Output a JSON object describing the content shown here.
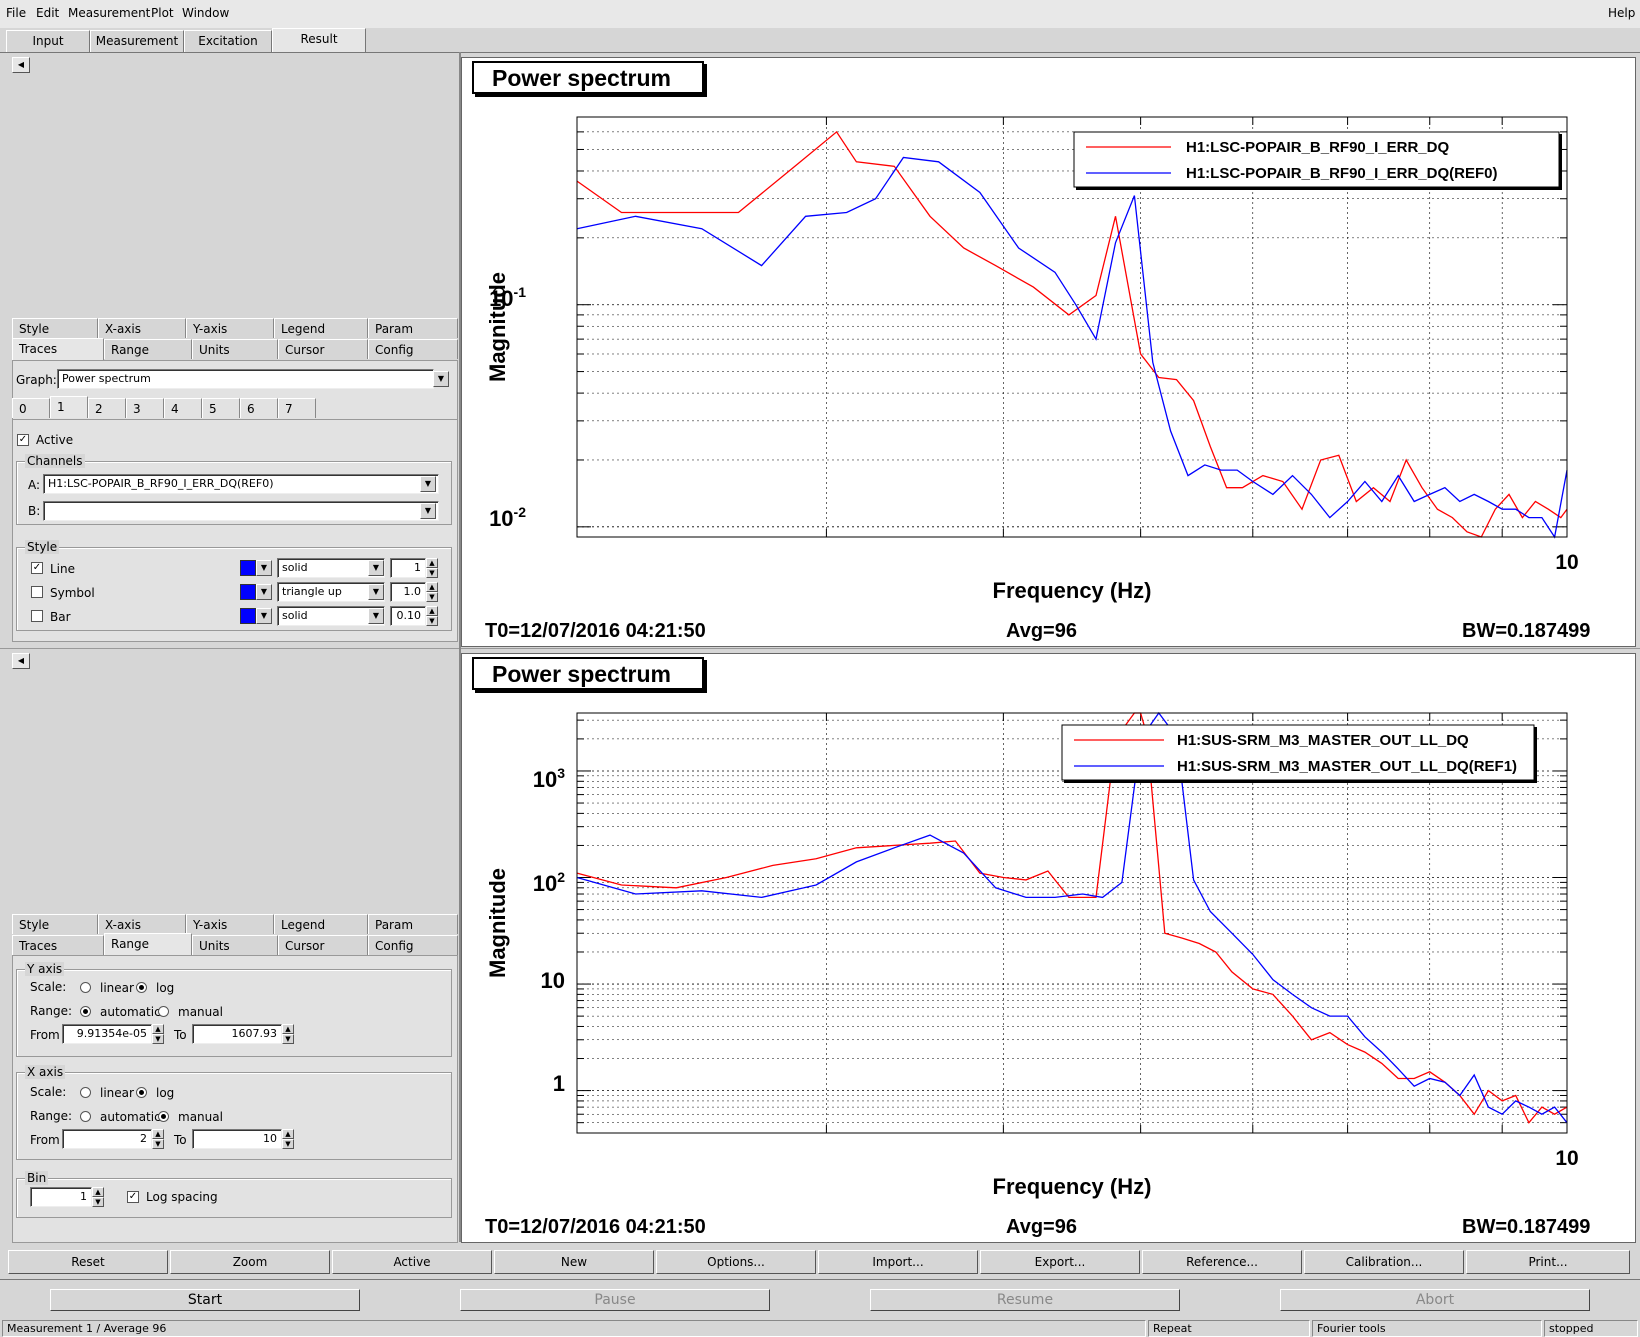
{
  "menu": {
    "file": "File",
    "edit": "Edit",
    "measurement": "Measurement",
    "plot": "Plot",
    "window": "Window",
    "help": "Help"
  },
  "main_tabs": {
    "input": "Input",
    "measurement": "Measurement",
    "excitation": "Excitation",
    "result": "Result"
  },
  "panel_tabs": {
    "style": "Style",
    "xaxis": "X-axis",
    "yaxis": "Y-axis",
    "legend": "Legend",
    "param": "Param",
    "traces": "Traces",
    "range": "Range",
    "units": "Units",
    "cursor": "Cursor",
    "config": "Config"
  },
  "traces_panel": {
    "graph_label": "Graph:",
    "graph_value": "Power spectrum",
    "trace_tabs": [
      "0",
      "1",
      "2",
      "3",
      "4",
      "5",
      "6",
      "7"
    ],
    "active_label": "Active",
    "channels_title": "Channels",
    "a_label": "A:",
    "a_value": "H1:LSC-POPAIR_B_RF90_I_ERR_DQ(REF0)",
    "b_label": "B:",
    "b_value": "",
    "style_title": "Style",
    "line_label": "Line",
    "symbol_label": "Symbol",
    "bar_label": "Bar",
    "line_style": "solid",
    "symbol_style": "triangle up",
    "bar_style": "solid",
    "line_width": "1",
    "symbol_size": "1.0",
    "bar_width": "0.10",
    "swatch_color": "#0000ff"
  },
  "range_panel": {
    "yaxis_title": "Y axis",
    "scale_label": "Scale:",
    "linear": "linear",
    "log": "log",
    "range_label": "Range:",
    "automatic": "automatic",
    "manual": "manual",
    "from_label": "From",
    "to_label": "To",
    "y_from": "9.91354e-05",
    "y_to": "1607.93",
    "xaxis_title": "X axis",
    "x_from": "2",
    "x_to": "10",
    "bin_title": "Bin",
    "bin_value": "1",
    "log_spacing": "Log spacing"
  },
  "plots": [
    {
      "title": "Power spectrum",
      "ylabel": "Magnitude",
      "xlabel": "Frequency (Hz)",
      "x_tick": "10",
      "t0": "T0=12/07/2016 04:21:50",
      "avg": "Avg=96",
      "bw": "BW=0.187499",
      "legend": [
        "H1:LSC-POPAIR_B_RF90_I_ERR_DQ",
        "H1:LSC-POPAIR_B_RF90_I_ERR_DQ(REF0)"
      ]
    },
    {
      "title": "Power spectrum",
      "ylabel": "Magnitude",
      "xlabel": "Frequency (Hz)",
      "x_tick": "10",
      "t0": "T0=12/07/2016 04:21:50",
      "avg": "Avg=96",
      "bw": "BW=0.187499",
      "legend": [
        "H1:SUS-SRM_M3_MASTER_OUT_LL_DQ",
        "H1:SUS-SRM_M3_MASTER_OUT_LL_DQ(REF1)"
      ]
    }
  ],
  "chart_data": [
    {
      "type": "line",
      "title": "Power spectrum",
      "xlabel": "Frequency (Hz)",
      "ylabel": "Magnitude",
      "xscale": "log",
      "yscale": "log",
      "xlim": [
        2,
        10
      ],
      "ylim": [
        0.009,
        0.7
      ],
      "y_tick_labels": [
        "10^-1",
        "10^-2"
      ],
      "x_tick_labels": [
        "10"
      ],
      "grid": true,
      "legend_position": "top-right",
      "series": [
        {
          "name": "H1:LSC-POPAIR_B_RF90_I_ERR_DQ",
          "color": "#ff0000",
          "x": [
            2.0,
            2.15,
            2.4,
            2.6,
            2.85,
            3.05,
            3.15,
            3.35,
            3.55,
            3.75,
            3.95,
            4.2,
            4.45,
            4.65,
            4.8,
            5.0,
            5.15,
            5.3,
            5.45,
            5.6,
            5.75,
            5.9,
            6.1,
            6.3,
            6.5,
            6.7,
            6.9,
            7.1,
            7.3,
            7.5,
            7.7,
            7.9,
            8.1,
            8.3,
            8.5,
            8.7,
            8.9,
            9.1,
            9.3,
            9.5,
            9.7,
            9.9,
            10.0
          ],
          "y": [
            0.36,
            0.26,
            0.26,
            0.26,
            0.42,
            0.6,
            0.44,
            0.42,
            0.25,
            0.18,
            0.15,
            0.12,
            0.09,
            0.11,
            0.25,
            0.06,
            0.047,
            0.046,
            0.037,
            0.023,
            0.015,
            0.015,
            0.017,
            0.016,
            0.012,
            0.02,
            0.021,
            0.013,
            0.015,
            0.013,
            0.02,
            0.015,
            0.012,
            0.011,
            0.0095,
            0.009,
            0.012,
            0.014,
            0.011,
            0.013,
            0.012,
            0.011,
            0.012
          ]
        },
        {
          "name": "H1:LSC-POPAIR_B_RF90_I_ERR_DQ(REF0)",
          "color": "#0000ff",
          "x": [
            2.0,
            2.2,
            2.45,
            2.7,
            2.9,
            3.1,
            3.25,
            3.4,
            3.6,
            3.85,
            4.1,
            4.35,
            4.5,
            4.65,
            4.8,
            4.95,
            5.1,
            5.25,
            5.4,
            5.55,
            5.7,
            5.85,
            6.0,
            6.2,
            6.4,
            6.6,
            6.8,
            7.0,
            7.2,
            7.4,
            7.6,
            7.8,
            8.0,
            8.2,
            8.4,
            8.6,
            8.8,
            9.0,
            9.2,
            9.4,
            9.6,
            9.8,
            10.0
          ],
          "y": [
            0.22,
            0.25,
            0.22,
            0.15,
            0.25,
            0.26,
            0.3,
            0.46,
            0.44,
            0.32,
            0.18,
            0.14,
            0.1,
            0.07,
            0.19,
            0.31,
            0.055,
            0.027,
            0.017,
            0.019,
            0.018,
            0.018,
            0.016,
            0.014,
            0.017,
            0.014,
            0.011,
            0.013,
            0.016,
            0.013,
            0.017,
            0.013,
            0.014,
            0.015,
            0.013,
            0.014,
            0.013,
            0.012,
            0.012,
            0.011,
            0.011,
            0.009,
            0.018
          ]
        }
      ]
    },
    {
      "type": "line",
      "title": "Power spectrum",
      "xlabel": "Frequency (Hz)",
      "ylabel": "Magnitude",
      "xscale": "log",
      "yscale": "log",
      "xlim": [
        2,
        10
      ],
      "ylim": [
        0.4,
        3500
      ],
      "y_tick_labels": [
        "10^3",
        "10^2",
        "10",
        "1"
      ],
      "x_tick_labels": [
        "10"
      ],
      "grid": true,
      "legend_position": "top-right",
      "series": [
        {
          "name": "H1:SUS-SRM_M3_MASTER_OUT_LL_DQ",
          "color": "#ff0000",
          "x": [
            2.0,
            2.15,
            2.35,
            2.55,
            2.75,
            2.95,
            3.15,
            3.35,
            3.55,
            3.7,
            3.85,
            4.0,
            4.15,
            4.3,
            4.45,
            4.55,
            4.65,
            4.8,
            4.95,
            5.0,
            5.05,
            5.2,
            5.35,
            5.5,
            5.65,
            5.8,
            6.0,
            6.2,
            6.4,
            6.6,
            6.8,
            7.0,
            7.2,
            7.4,
            7.6,
            7.8,
            8.0,
            8.2,
            8.4,
            8.6,
            8.8,
            9.0,
            9.2,
            9.4,
            9.6,
            9.8,
            10.0
          ],
          "y": [
            110,
            85,
            80,
            100,
            130,
            150,
            190,
            200,
            210,
            220,
            110,
            100,
            95,
            115,
            65,
            65,
            65,
            2000,
            3800,
            3600,
            2200,
            30,
            27,
            24,
            20,
            13,
            9,
            8,
            5,
            3,
            3.5,
            2.7,
            2.3,
            1.8,
            1.3,
            1.3,
            1.5,
            1.2,
            0.9,
            0.6,
            1.0,
            0.8,
            0.9,
            0.5,
            0.7,
            0.6,
            0.7
          ]
        },
        {
          "name": "H1:SUS-SRM_M3_MASTER_OUT_LL_DQ(REF1)",
          "color": "#0000ff",
          "x": [
            2.0,
            2.2,
            2.45,
            2.7,
            2.95,
            3.15,
            3.35,
            3.55,
            3.75,
            3.95,
            4.15,
            4.35,
            4.55,
            4.7,
            4.85,
            5.0,
            5.15,
            5.3,
            5.45,
            5.6,
            5.8,
            6.0,
            6.2,
            6.4,
            6.6,
            6.8,
            7.0,
            7.2,
            7.4,
            7.6,
            7.8,
            8.0,
            8.2,
            8.4,
            8.6,
            8.8,
            9.0,
            9.2,
            9.4,
            9.6,
            9.8,
            10.0
          ],
          "y": [
            100,
            70,
            75,
            65,
            85,
            140,
            190,
            250,
            170,
            80,
            65,
            65,
            70,
            65,
            90,
            2000,
            3700,
            2100,
            95,
            48,
            30,
            19,
            11,
            8,
            6,
            5,
            5,
            3.2,
            2.3,
            1.6,
            1.1,
            1.3,
            1.2,
            0.9,
            1.4,
            0.7,
            0.6,
            0.8,
            0.7,
            0.6,
            0.7,
            0.5
          ]
        }
      ]
    }
  ],
  "bottom_buttons": [
    "Reset",
    "Zoom",
    "Active",
    "New",
    "Options...",
    "Import...",
    "Export...",
    "Reference...",
    "Calibration...",
    "Print..."
  ],
  "control": {
    "start": "Start",
    "pause": "Pause",
    "resume": "Resume",
    "abort": "Abort"
  },
  "status": {
    "left": "Measurement 1 / Average 96",
    "repeat": "Repeat",
    "tools": "Fourier tools",
    "state": "stopped"
  }
}
